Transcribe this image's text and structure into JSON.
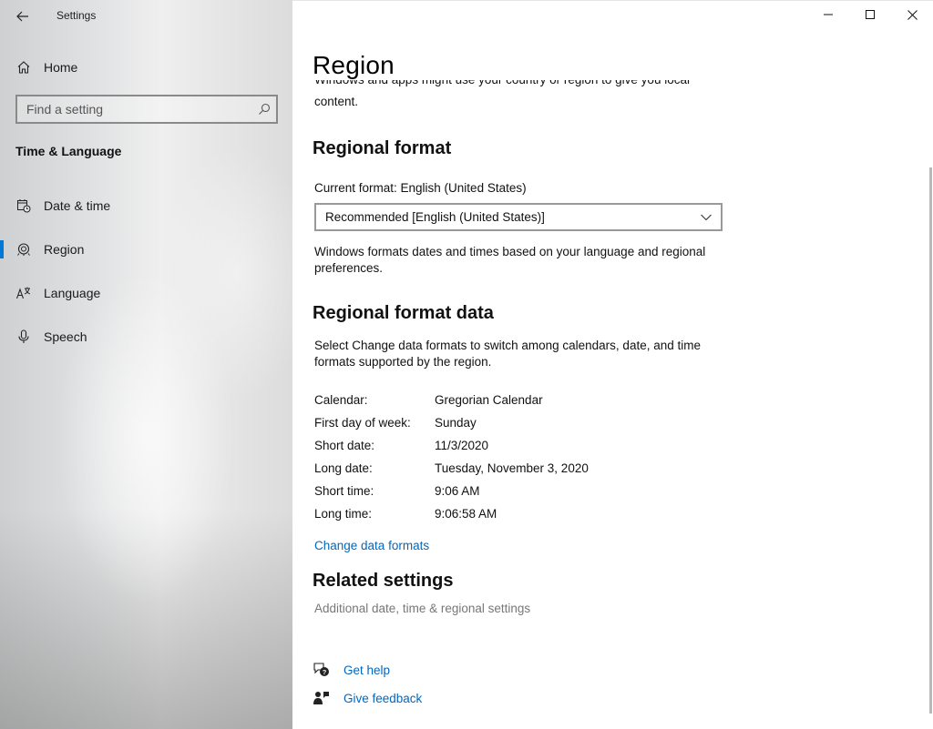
{
  "app": {
    "title": "Settings"
  },
  "sidebar": {
    "home_label": "Home",
    "search": {
      "placeholder": "Find a setting",
      "value": ""
    },
    "section_header": "Time & Language",
    "items": [
      {
        "label": "Date & time",
        "icon": "calendar-clock-icon"
      },
      {
        "label": "Region",
        "icon": "globe-icon",
        "selected": true
      },
      {
        "label": "Language",
        "icon": "language-icon"
      },
      {
        "label": "Speech",
        "icon": "microphone-icon"
      }
    ]
  },
  "main": {
    "title": "Region",
    "intro_partial": "Windows and apps might use your country or region to give you local",
    "intro_end": "content.",
    "regional_format": {
      "heading": "Regional format",
      "current_format_label": "Current format: English (United States)",
      "dropdown_value": "Recommended [English (United States)]",
      "description": "Windows formats dates and times based on your language and regional preferences."
    },
    "format_data": {
      "heading": "Regional format data",
      "description": "Select Change data formats to switch among calendars, date, and time formats supported by the region.",
      "rows": [
        {
          "key": "Calendar:",
          "value": "Gregorian Calendar"
        },
        {
          "key": "First day of week:",
          "value": "Sunday"
        },
        {
          "key": "Short date:",
          "value": "11/3/2020"
        },
        {
          "key": "Long date:",
          "value": "Tuesday, November 3, 2020"
        },
        {
          "key": "Short time:",
          "value": "9:06 AM"
        },
        {
          "key": "Long time:",
          "value": "9:06:58 AM"
        }
      ],
      "change_link": "Change data formats"
    },
    "related": {
      "heading": "Related settings",
      "link": "Additional date, time & regional settings"
    },
    "help": {
      "get_help": "Get help",
      "give_feedback": "Give feedback"
    }
  },
  "colors": {
    "accent": "#0078d7",
    "link": "#0067c0",
    "muted_link": "#777777"
  }
}
